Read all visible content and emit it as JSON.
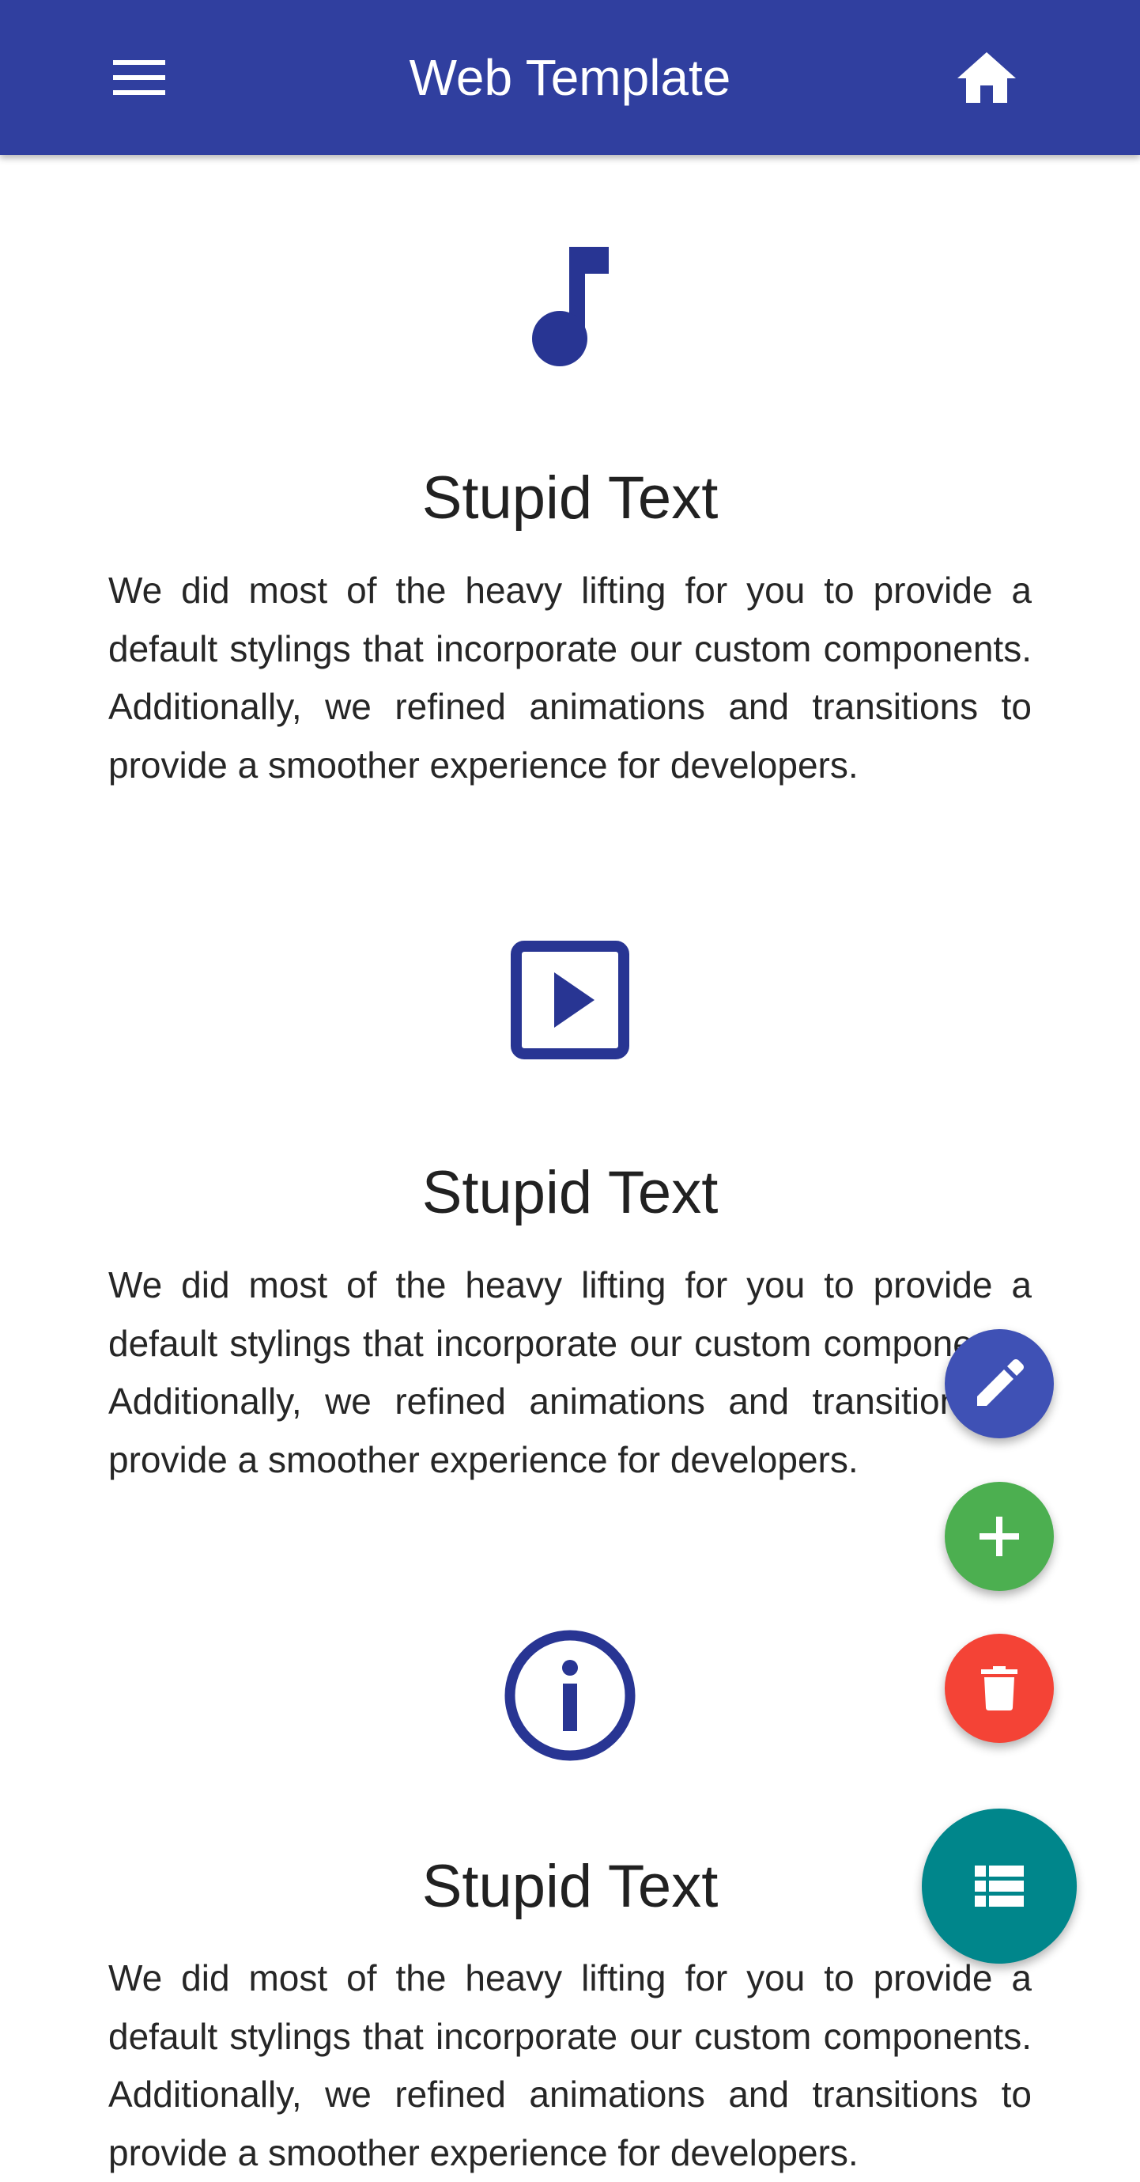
{
  "app_bar": {
    "title": "Web Template",
    "menu_icon": "hamburger-menu-icon",
    "home_icon": "home-icon",
    "color": "#303f9f"
  },
  "sections": [
    {
      "icon": "music-note-icon",
      "title": "Stupid Text",
      "text": "We did most of the heavy lifting for you to provide a default stylings that incorporate our custom components. Additionally, we refined animations and transitions to provide a smoother experience for developers."
    },
    {
      "icon": "play-box-icon",
      "title": "Stupid Text",
      "text": "We did most of the heavy lifting for you to provide a default stylings that incorporate our custom components. Additionally, we refined animations and transitions to provide a smoother experience for developers."
    },
    {
      "icon": "info-circle-icon",
      "title": "Stupid Text",
      "text": "We did most of the heavy lifting for you to provide a default stylings that incorporate our custom components. Additionally, we refined animations and transitions to provide a smoother experience for developers."
    }
  ],
  "fabs": [
    {
      "icon": "pencil-icon",
      "color": "#3f51b5"
    },
    {
      "icon": "plus-icon",
      "color": "#4caf50"
    },
    {
      "icon": "trash-icon",
      "color": "#f44336"
    },
    {
      "icon": "list-icon",
      "color": "#00868b"
    }
  ],
  "colors": {
    "primary": "#303f9f",
    "icon": "#283593"
  }
}
